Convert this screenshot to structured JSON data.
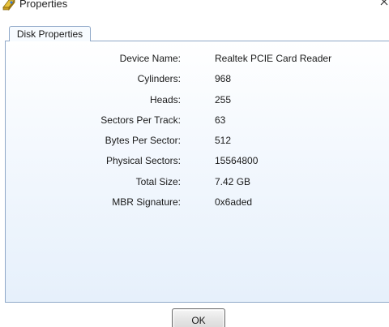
{
  "window": {
    "title": "Properties",
    "app_icon": "drive-icon",
    "close_icon": "close-icon"
  },
  "tabs": [
    {
      "label": "Disk Properties",
      "selected": true
    }
  ],
  "properties": [
    {
      "label": "Device Name:",
      "value": "Realtek PCIE Card Reader"
    },
    {
      "label": "Cylinders:",
      "value": "968"
    },
    {
      "label": "Heads:",
      "value": "255"
    },
    {
      "label": "Sectors Per Track:",
      "value": "63"
    },
    {
      "label": "Bytes Per Sector:",
      "value": "512"
    },
    {
      "label": "Physical Sectors:",
      "value": "15564800"
    },
    {
      "label": "Total Size:",
      "value": "7.42 GB"
    },
    {
      "label": "MBR Signature:",
      "value": "0x6aded"
    }
  ],
  "footer": {
    "ok_label": "OK"
  },
  "colors": {
    "panel_border": "#8fa8c8",
    "panel_gradient_bottom": "#e6f0fb"
  }
}
